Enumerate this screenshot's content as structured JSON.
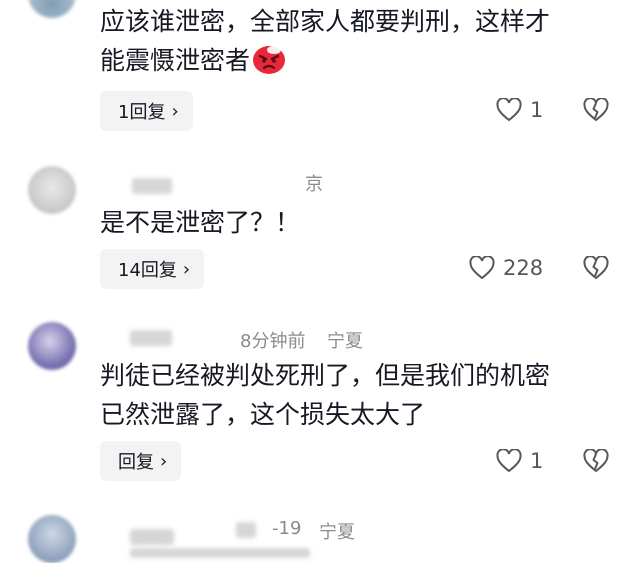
{
  "comments": [
    {
      "text": "应该谁泄密，全部家人都要判刑，这样才\n能震慑泄密者",
      "emoji": "angry-face-emoji",
      "reply_label": "1回复",
      "likes": "1"
    },
    {
      "location_partial": "京",
      "text": "是不是泄密了？！",
      "reply_label": "14回复",
      "likes": "228"
    },
    {
      "time": "8分钟前",
      "location": "宁夏",
      "text": "判徒已经被判处死刑了，但是我们的机密\n已然泄露了，这个损失太大了",
      "reply_label": "回复",
      "likes": "1"
    },
    {
      "date_partial": "-19",
      "location": "宁夏"
    }
  ],
  "colors": {
    "text": "#161823",
    "muted": "#8a8b91",
    "reply_bg": "#f3f3f4",
    "emoji_red": "#e8283a"
  }
}
